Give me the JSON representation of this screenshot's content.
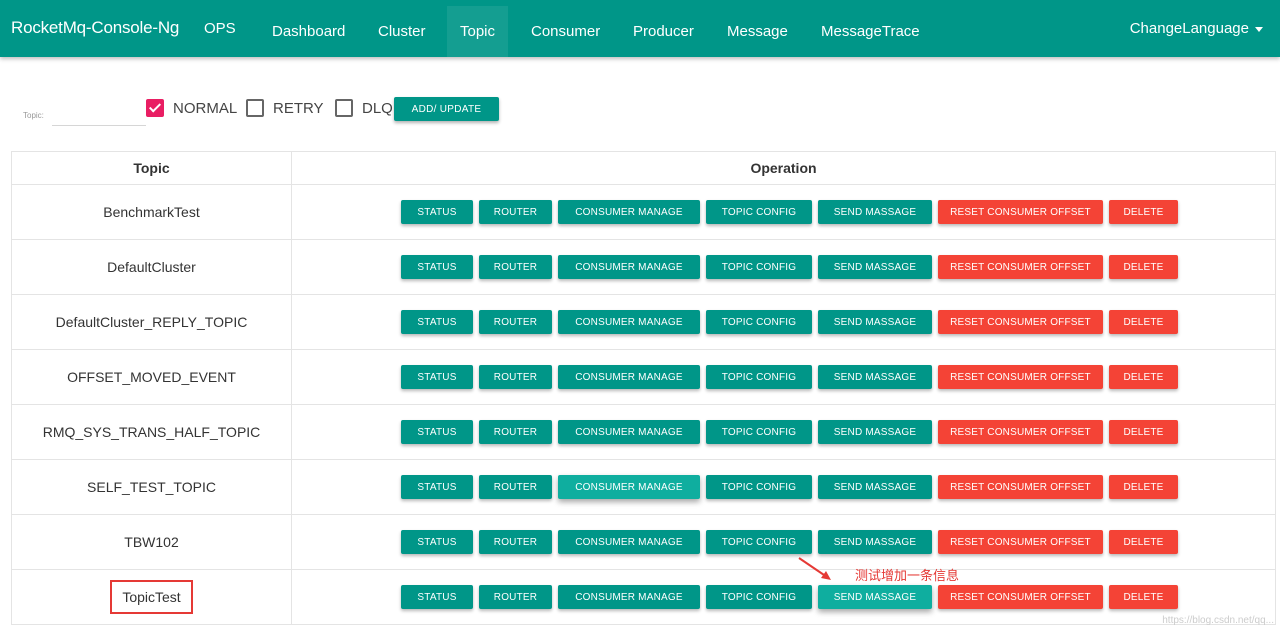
{
  "navbar": {
    "brand": "RocketMq-Console-Ng",
    "ops": "OPS",
    "items": [
      "Dashboard",
      "Cluster",
      "Topic",
      "Consumer",
      "Producer",
      "Message",
      "MessageTrace"
    ],
    "active": "Topic",
    "change_language": "ChangeLanguage",
    "color": "#009688"
  },
  "filter": {
    "label": "Topic:",
    "input_value": "",
    "checkboxes": [
      {
        "label": "NORMAL",
        "checked": true
      },
      {
        "label": "RETRY",
        "checked": false
      },
      {
        "label": "DLQ",
        "checked": false
      }
    ],
    "add_update_label": "ADD/ UPDATE"
  },
  "table": {
    "headers": {
      "topic": "Topic",
      "operation": "Operation"
    },
    "operations": {
      "status": "STATUS",
      "router": "ROUTER",
      "consumer_manage": "CONSUMER MANAGE",
      "topic_config": "TOPIC CONFIG",
      "send_message": "SEND MASSAGE",
      "reset_consumer_offset": "RESET CONSUMER OFFSET",
      "delete": "DELETE"
    },
    "rows": [
      "BenchmarkTest",
      "DefaultCluster",
      "DefaultCluster_REPLY_TOPIC",
      "OFFSET_MOVED_EVENT",
      "RMQ_SYS_TRANS_HALF_TOPIC",
      "SELF_TEST_TOPIC",
      "TBW102",
      "TopicTest"
    ]
  },
  "annotation": {
    "text": "测试增加一条信息"
  },
  "watermark": "https://blog.csdn.net/qq..."
}
